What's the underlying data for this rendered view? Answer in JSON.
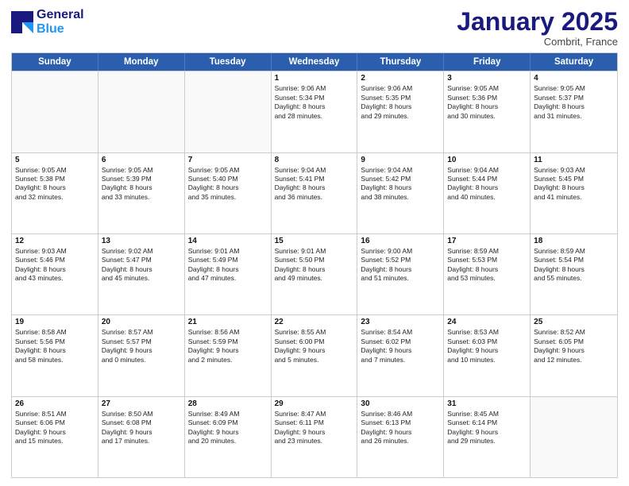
{
  "header": {
    "logo_line1": "General",
    "logo_line2": "Blue",
    "month": "January 2025",
    "location": "Combrit, France"
  },
  "days_of_week": [
    "Sunday",
    "Monday",
    "Tuesday",
    "Wednesday",
    "Thursday",
    "Friday",
    "Saturday"
  ],
  "weeks": [
    [
      {
        "day": "",
        "lines": [],
        "empty": true
      },
      {
        "day": "",
        "lines": [],
        "empty": true
      },
      {
        "day": "",
        "lines": [],
        "empty": true
      },
      {
        "day": "1",
        "lines": [
          "Sunrise: 9:06 AM",
          "Sunset: 5:34 PM",
          "Daylight: 8 hours",
          "and 28 minutes."
        ]
      },
      {
        "day": "2",
        "lines": [
          "Sunrise: 9:06 AM",
          "Sunset: 5:35 PM",
          "Daylight: 8 hours",
          "and 29 minutes."
        ]
      },
      {
        "day": "3",
        "lines": [
          "Sunrise: 9:05 AM",
          "Sunset: 5:36 PM",
          "Daylight: 8 hours",
          "and 30 minutes."
        ]
      },
      {
        "day": "4",
        "lines": [
          "Sunrise: 9:05 AM",
          "Sunset: 5:37 PM",
          "Daylight: 8 hours",
          "and 31 minutes."
        ]
      }
    ],
    [
      {
        "day": "5",
        "lines": [
          "Sunrise: 9:05 AM",
          "Sunset: 5:38 PM",
          "Daylight: 8 hours",
          "and 32 minutes."
        ]
      },
      {
        "day": "6",
        "lines": [
          "Sunrise: 9:05 AM",
          "Sunset: 5:39 PM",
          "Daylight: 8 hours",
          "and 33 minutes."
        ]
      },
      {
        "day": "7",
        "lines": [
          "Sunrise: 9:05 AM",
          "Sunset: 5:40 PM",
          "Daylight: 8 hours",
          "and 35 minutes."
        ]
      },
      {
        "day": "8",
        "lines": [
          "Sunrise: 9:04 AM",
          "Sunset: 5:41 PM",
          "Daylight: 8 hours",
          "and 36 minutes."
        ]
      },
      {
        "day": "9",
        "lines": [
          "Sunrise: 9:04 AM",
          "Sunset: 5:42 PM",
          "Daylight: 8 hours",
          "and 38 minutes."
        ]
      },
      {
        "day": "10",
        "lines": [
          "Sunrise: 9:04 AM",
          "Sunset: 5:44 PM",
          "Daylight: 8 hours",
          "and 40 minutes."
        ]
      },
      {
        "day": "11",
        "lines": [
          "Sunrise: 9:03 AM",
          "Sunset: 5:45 PM",
          "Daylight: 8 hours",
          "and 41 minutes."
        ]
      }
    ],
    [
      {
        "day": "12",
        "lines": [
          "Sunrise: 9:03 AM",
          "Sunset: 5:46 PM",
          "Daylight: 8 hours",
          "and 43 minutes."
        ]
      },
      {
        "day": "13",
        "lines": [
          "Sunrise: 9:02 AM",
          "Sunset: 5:47 PM",
          "Daylight: 8 hours",
          "and 45 minutes."
        ]
      },
      {
        "day": "14",
        "lines": [
          "Sunrise: 9:01 AM",
          "Sunset: 5:49 PM",
          "Daylight: 8 hours",
          "and 47 minutes."
        ]
      },
      {
        "day": "15",
        "lines": [
          "Sunrise: 9:01 AM",
          "Sunset: 5:50 PM",
          "Daylight: 8 hours",
          "and 49 minutes."
        ]
      },
      {
        "day": "16",
        "lines": [
          "Sunrise: 9:00 AM",
          "Sunset: 5:52 PM",
          "Daylight: 8 hours",
          "and 51 minutes."
        ]
      },
      {
        "day": "17",
        "lines": [
          "Sunrise: 8:59 AM",
          "Sunset: 5:53 PM",
          "Daylight: 8 hours",
          "and 53 minutes."
        ]
      },
      {
        "day": "18",
        "lines": [
          "Sunrise: 8:59 AM",
          "Sunset: 5:54 PM",
          "Daylight: 8 hours",
          "and 55 minutes."
        ]
      }
    ],
    [
      {
        "day": "19",
        "lines": [
          "Sunrise: 8:58 AM",
          "Sunset: 5:56 PM",
          "Daylight: 8 hours",
          "and 58 minutes."
        ]
      },
      {
        "day": "20",
        "lines": [
          "Sunrise: 8:57 AM",
          "Sunset: 5:57 PM",
          "Daylight: 9 hours",
          "and 0 minutes."
        ]
      },
      {
        "day": "21",
        "lines": [
          "Sunrise: 8:56 AM",
          "Sunset: 5:59 PM",
          "Daylight: 9 hours",
          "and 2 minutes."
        ]
      },
      {
        "day": "22",
        "lines": [
          "Sunrise: 8:55 AM",
          "Sunset: 6:00 PM",
          "Daylight: 9 hours",
          "and 5 minutes."
        ]
      },
      {
        "day": "23",
        "lines": [
          "Sunrise: 8:54 AM",
          "Sunset: 6:02 PM",
          "Daylight: 9 hours",
          "and 7 minutes."
        ]
      },
      {
        "day": "24",
        "lines": [
          "Sunrise: 8:53 AM",
          "Sunset: 6:03 PM",
          "Daylight: 9 hours",
          "and 10 minutes."
        ]
      },
      {
        "day": "25",
        "lines": [
          "Sunrise: 8:52 AM",
          "Sunset: 6:05 PM",
          "Daylight: 9 hours",
          "and 12 minutes."
        ]
      }
    ],
    [
      {
        "day": "26",
        "lines": [
          "Sunrise: 8:51 AM",
          "Sunset: 6:06 PM",
          "Daylight: 9 hours",
          "and 15 minutes."
        ]
      },
      {
        "day": "27",
        "lines": [
          "Sunrise: 8:50 AM",
          "Sunset: 6:08 PM",
          "Daylight: 9 hours",
          "and 17 minutes."
        ]
      },
      {
        "day": "28",
        "lines": [
          "Sunrise: 8:49 AM",
          "Sunset: 6:09 PM",
          "Daylight: 9 hours",
          "and 20 minutes."
        ]
      },
      {
        "day": "29",
        "lines": [
          "Sunrise: 8:47 AM",
          "Sunset: 6:11 PM",
          "Daylight: 9 hours",
          "and 23 minutes."
        ]
      },
      {
        "day": "30",
        "lines": [
          "Sunrise: 8:46 AM",
          "Sunset: 6:13 PM",
          "Daylight: 9 hours",
          "and 26 minutes."
        ]
      },
      {
        "day": "31",
        "lines": [
          "Sunrise: 8:45 AM",
          "Sunset: 6:14 PM",
          "Daylight: 9 hours",
          "and 29 minutes."
        ]
      },
      {
        "day": "",
        "lines": [],
        "empty": true
      }
    ]
  ]
}
